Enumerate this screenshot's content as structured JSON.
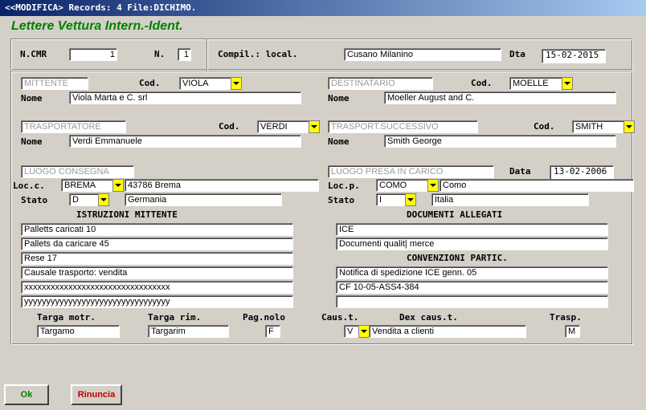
{
  "window": {
    "title": "<<MODIFICA> Records: 4 File:DICHIMO."
  },
  "app_title": "Lettere Vettura Intern.-Ident.",
  "header": {
    "ncmr_label": "N.CMR",
    "ncmr_value": "1",
    "n_label": "N.",
    "n_value": "1",
    "compil_label": "Compil.: local.",
    "compil_value": "Cusano Milanino",
    "dta_label": "Dta",
    "dta_value": "15-02-2015"
  },
  "mittente": {
    "placeholder": "MITTENTE",
    "cod_label": "Cod.",
    "cod": "VIOLA",
    "nome_label": "Nome",
    "nome": "Viola Marta e C. srl"
  },
  "destinatario": {
    "placeholder": "DESTINATARIO",
    "cod_label": "Cod.",
    "cod": "MOELLE",
    "nome_label": "Nome",
    "nome": "Moeller August and C."
  },
  "trasportatore": {
    "placeholder": "TRASPORTATORE",
    "cod_label": "Cod.",
    "cod": "VERDI",
    "nome_label": "Nome",
    "nome": "Verdi Emmanuele"
  },
  "trasp_successivo": {
    "placeholder": "TRASPORT.SUCCESSIVO",
    "cod_label": "Cod.",
    "cod": "SMITH",
    "nome_label": "Nome",
    "nome": "Smith George"
  },
  "consegna": {
    "placeholder": "LUOGO CONSEGNA",
    "loc_label": "Loc.c.",
    "loc_code": "BREMA",
    "loc_desc": "43786 Brema",
    "stato_label": "Stato",
    "stato_code": "D",
    "stato_desc": "Germania"
  },
  "presa": {
    "placeholder": "LUOGO PRESA IN CARICO",
    "data_label": "Data",
    "data_value": "13-02-2006",
    "loc_label": "Loc.p.",
    "loc_code": "COMO",
    "loc_desc": "Como",
    "stato_label": "Stato",
    "stato_code": "I",
    "stato_desc": "Italia"
  },
  "istruzioni": {
    "heading": "ISTRUZIONI MITTENTE",
    "lines": [
      "Palletts caricati 10",
      "Pallets da caricare 45",
      "Rese  17",
      "Causale trasporto: vendita",
      "xxxxxxxxxxxxxxxxxxxxxxxxxxxxxxxxx",
      "yyyyyyyyyyyyyyyyyyyyyyyyyyyyyyyyy"
    ]
  },
  "documenti": {
    "heading": "DOCUMENTI ALLEGATI",
    "lines": [
      "ICE",
      "Documenti qualit| merce"
    ]
  },
  "convenzioni": {
    "heading": "CONVENZIONI PARTIC.",
    "lines": [
      "Notifica di spedizione ICE genn. 05",
      "CF  10-05-ASS4-384",
      ""
    ]
  },
  "footer": {
    "targa_motr_label": "Targa motr.",
    "targa_motr": "Targamo",
    "targa_rim_label": "Targa rim.",
    "targa_rim": "Targarim",
    "pagnolo_label": "Pag.nolo",
    "pagnolo": "F",
    "caust_label": "Caus.t.",
    "caust": "V",
    "dex_label": "Dex caus.t.",
    "dex": "Vendita a clienti",
    "trasp_label": "Trasp.",
    "trasp": "M"
  },
  "buttons": {
    "ok": "Ok",
    "cancel": "Rinuncia"
  },
  "colors": {
    "accent_yellow": "#ffff00",
    "title_green": "#008000",
    "cancel_red": "#c00000",
    "titlebar_blue": "#0a246a"
  }
}
